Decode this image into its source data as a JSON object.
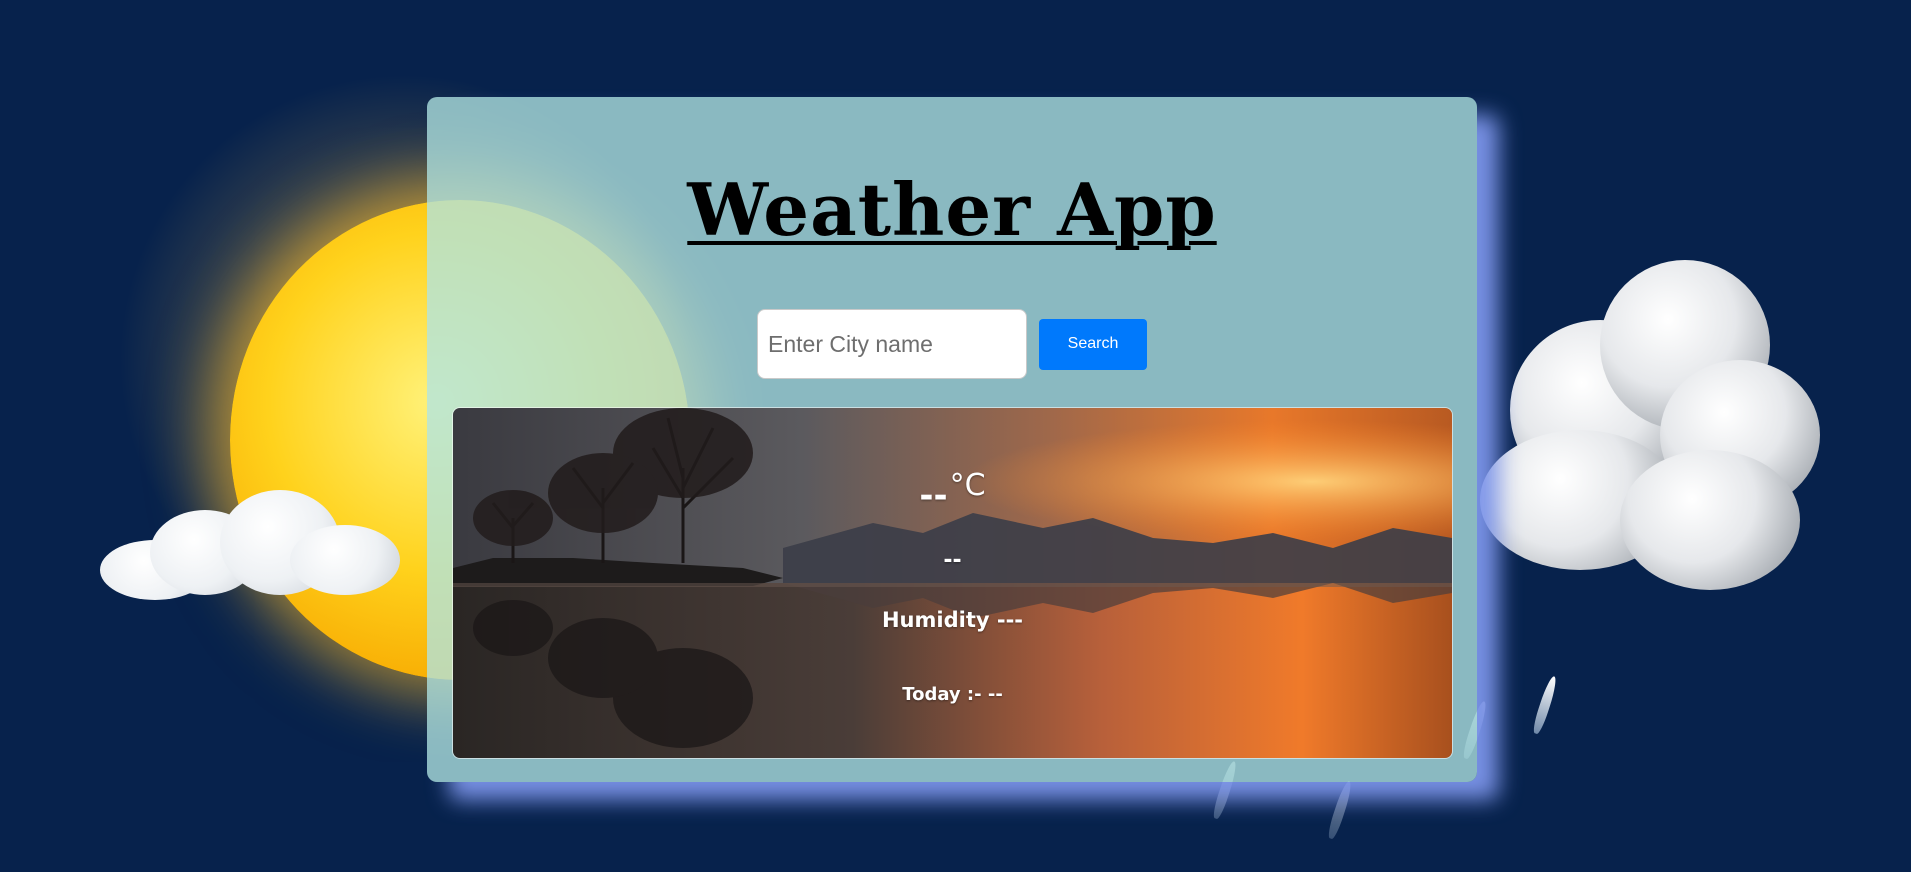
{
  "app": {
    "title": "Weather App"
  },
  "search": {
    "placeholder": "Enter City name",
    "value": "",
    "button_label": "Search"
  },
  "weather": {
    "temperature": "--",
    "unit": "°C",
    "condition": "--",
    "humidity_text": "Humidity ---",
    "today_text": "Today :- --"
  },
  "colors": {
    "page_background": "#07224c",
    "card_background": "#b0e4e3",
    "card_shadow": "#7d96eb",
    "search_button": "#0079fc"
  },
  "icons": {
    "sun": "sun-illustration",
    "cloud_left": "cloud-illustration",
    "cloud_right": "rain-cloud-illustration"
  }
}
